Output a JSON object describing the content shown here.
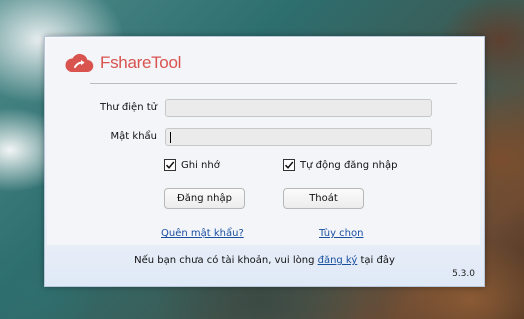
{
  "app": {
    "name": "FshareTool",
    "logo_icon": "cloud-upload-icon",
    "brand_color": "#d9534f",
    "version": "5.3.0"
  },
  "form": {
    "email_label": "Thư điện tử",
    "email_value": "",
    "password_label": "Mật khẩu",
    "password_value": "",
    "remember_label": "Ghi nhớ",
    "remember_checked": true,
    "auto_login_label": "Tự động đăng nhập",
    "auto_login_checked": true,
    "login_button": "Đăng nhập",
    "exit_button": "Thoát",
    "forgot_link": "Quên mật khẩu?",
    "options_link": "Tùy chọn"
  },
  "footer": {
    "text_before": "Nếu bạn chưa có tài khoản, vui lòng ",
    "register_link": "đăng ký",
    "text_after": " tại đây"
  }
}
